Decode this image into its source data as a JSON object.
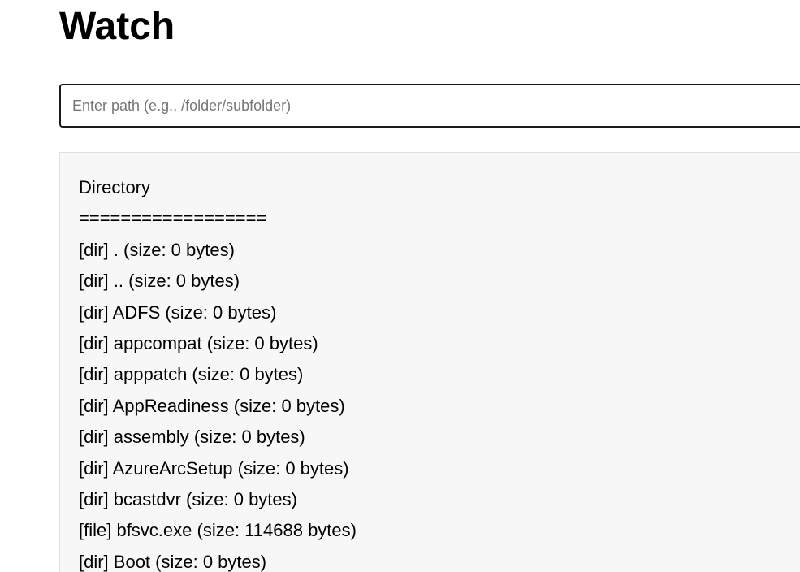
{
  "page": {
    "title": "Watch"
  },
  "path_input": {
    "value": "",
    "placeholder": "Enter path (e.g., /folder/subfolder)"
  },
  "listing": {
    "heading": "Directory",
    "separator": "==================",
    "entries": [
      "[dir] . (size: 0 bytes)",
      "[dir] .. (size: 0 bytes)",
      "[dir] ADFS (size: 0 bytes)",
      "[dir] appcompat (size: 0 bytes)",
      "[dir] apppatch (size: 0 bytes)",
      "[dir] AppReadiness (size: 0 bytes)",
      "[dir] assembly (size: 0 bytes)",
      "[dir] AzureArcSetup (size: 0 bytes)",
      "[dir] bcastdvr (size: 0 bytes)",
      "[file] bfsvc.exe (size: 114688 bytes)",
      "[dir] Boot (size: 0 bytes)"
    ]
  }
}
